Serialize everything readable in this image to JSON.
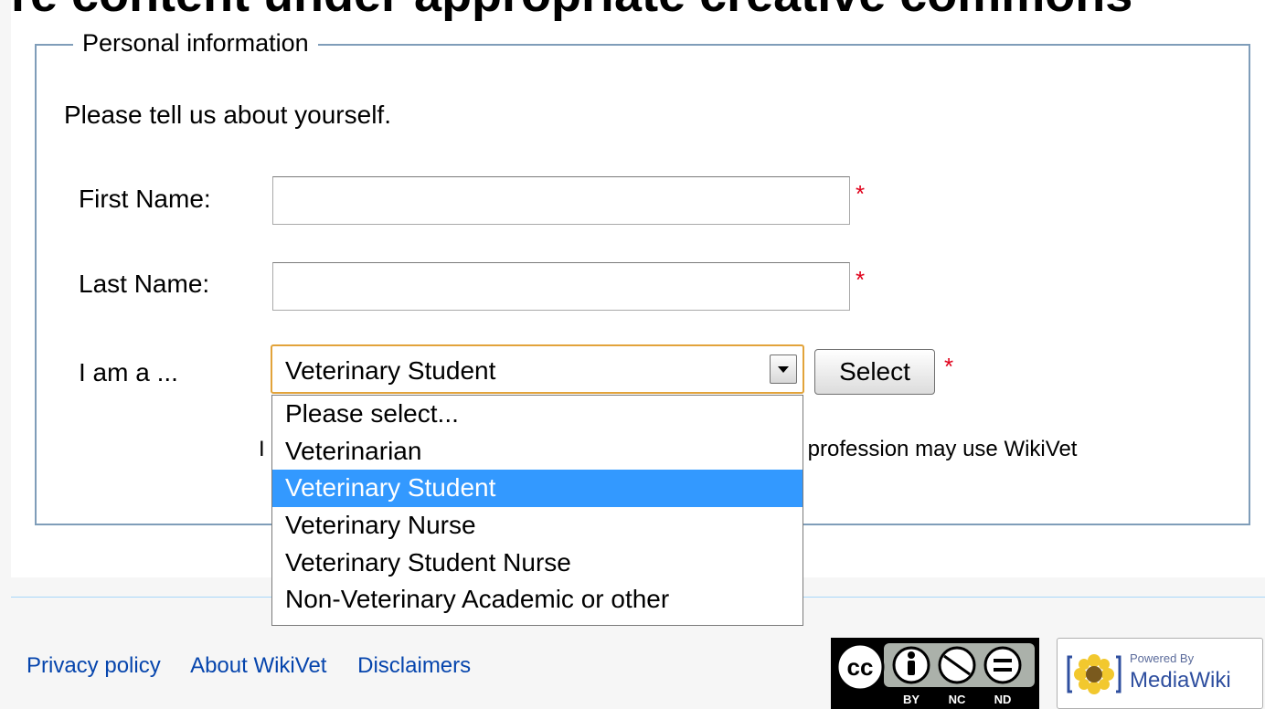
{
  "header": {
    "cutoff_text": "re content under appropriate creative commons"
  },
  "form": {
    "legend": "Personal information",
    "intro": "Please tell us about yourself.",
    "first_name": {
      "label": "First Name:",
      "value": "",
      "required_mark": "*"
    },
    "last_name": {
      "label": "Last Name:",
      "value": "",
      "required_mark": "*"
    },
    "role": {
      "label": "I am a ...",
      "selected": "Veterinary Student",
      "required_mark": "*",
      "options": [
        "Please select...",
        "Veterinarian",
        "Veterinary Student",
        "Veterinary Nurse",
        "Veterinary Student Nurse",
        "Non-Veterinary Academic or other"
      ]
    },
    "select_button": "Select",
    "note_fragment_left": "I",
    "note_fragment_right": "profession may use WikiVet"
  },
  "footer": {
    "links": [
      "Privacy policy",
      "About WikiVet",
      "Disclaimers"
    ],
    "cc_license_labels": [
      "BY",
      "NC",
      "ND"
    ],
    "cc_logo_text": "cc",
    "mediawiki_badge": {
      "powered_by": "Powered By",
      "name": "MediaWiki"
    }
  },
  "colors": {
    "fieldset_border": "#7f9db9",
    "required": "#e0001a",
    "link": "#0645ad",
    "selected_option_bg": "#3399ff",
    "select_focus_border": "#e2a33a",
    "footer_rule": "#a7d7f9"
  },
  "icons": [
    "dropdown-arrow-icon",
    "creative-commons-icon",
    "mediawiki-sunflower-icon"
  ]
}
